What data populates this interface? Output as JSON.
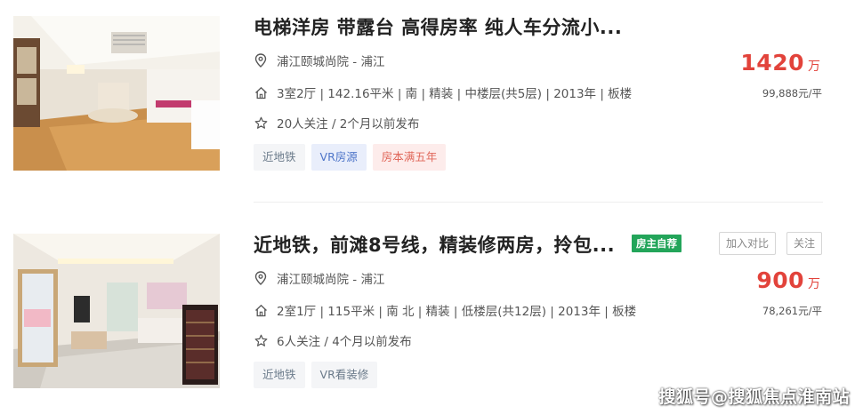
{
  "listings": [
    {
      "title": "电梯洋房 带露台 高得房率 纯人车分流小...",
      "location": "浦江颐城尚院 - 浦江",
      "info": "3室2厅 | 142.16平米 | 南 | 精装 | 中楼层(共5层) | 2013年 | 板楼",
      "follow": "20人关注 / 2个月以前发布",
      "tags": [
        "近地铁",
        "VR房源",
        "房本满五年"
      ],
      "price": "1420",
      "price_unit": "万",
      "unit_price": "99,888元/平"
    },
    {
      "title": "近地铁，前滩8号线，精装修两房，拎包...",
      "badge": "房主自荐",
      "compare_label": "加入对比",
      "follow_label": "关注",
      "location": "浦江颐城尚院 - 浦江",
      "info": "2室1厅 | 115平米 | 南 北 | 精装 | 低楼层(共12层) | 2013年 | 板楼",
      "follow": "6人关注 / 4个月以前发布",
      "tags": [
        "近地铁",
        "VR看装修"
      ],
      "price": "900",
      "price_unit": "万",
      "unit_price": "78,261元/平"
    }
  ],
  "watermark": "搜狐号@搜狐焦点淮南站",
  "colors": {
    "price": "#e2433b",
    "owner_badge": "#23a55a",
    "tag_blue": "#4f76c9",
    "tag_pink": "#e0675a"
  }
}
